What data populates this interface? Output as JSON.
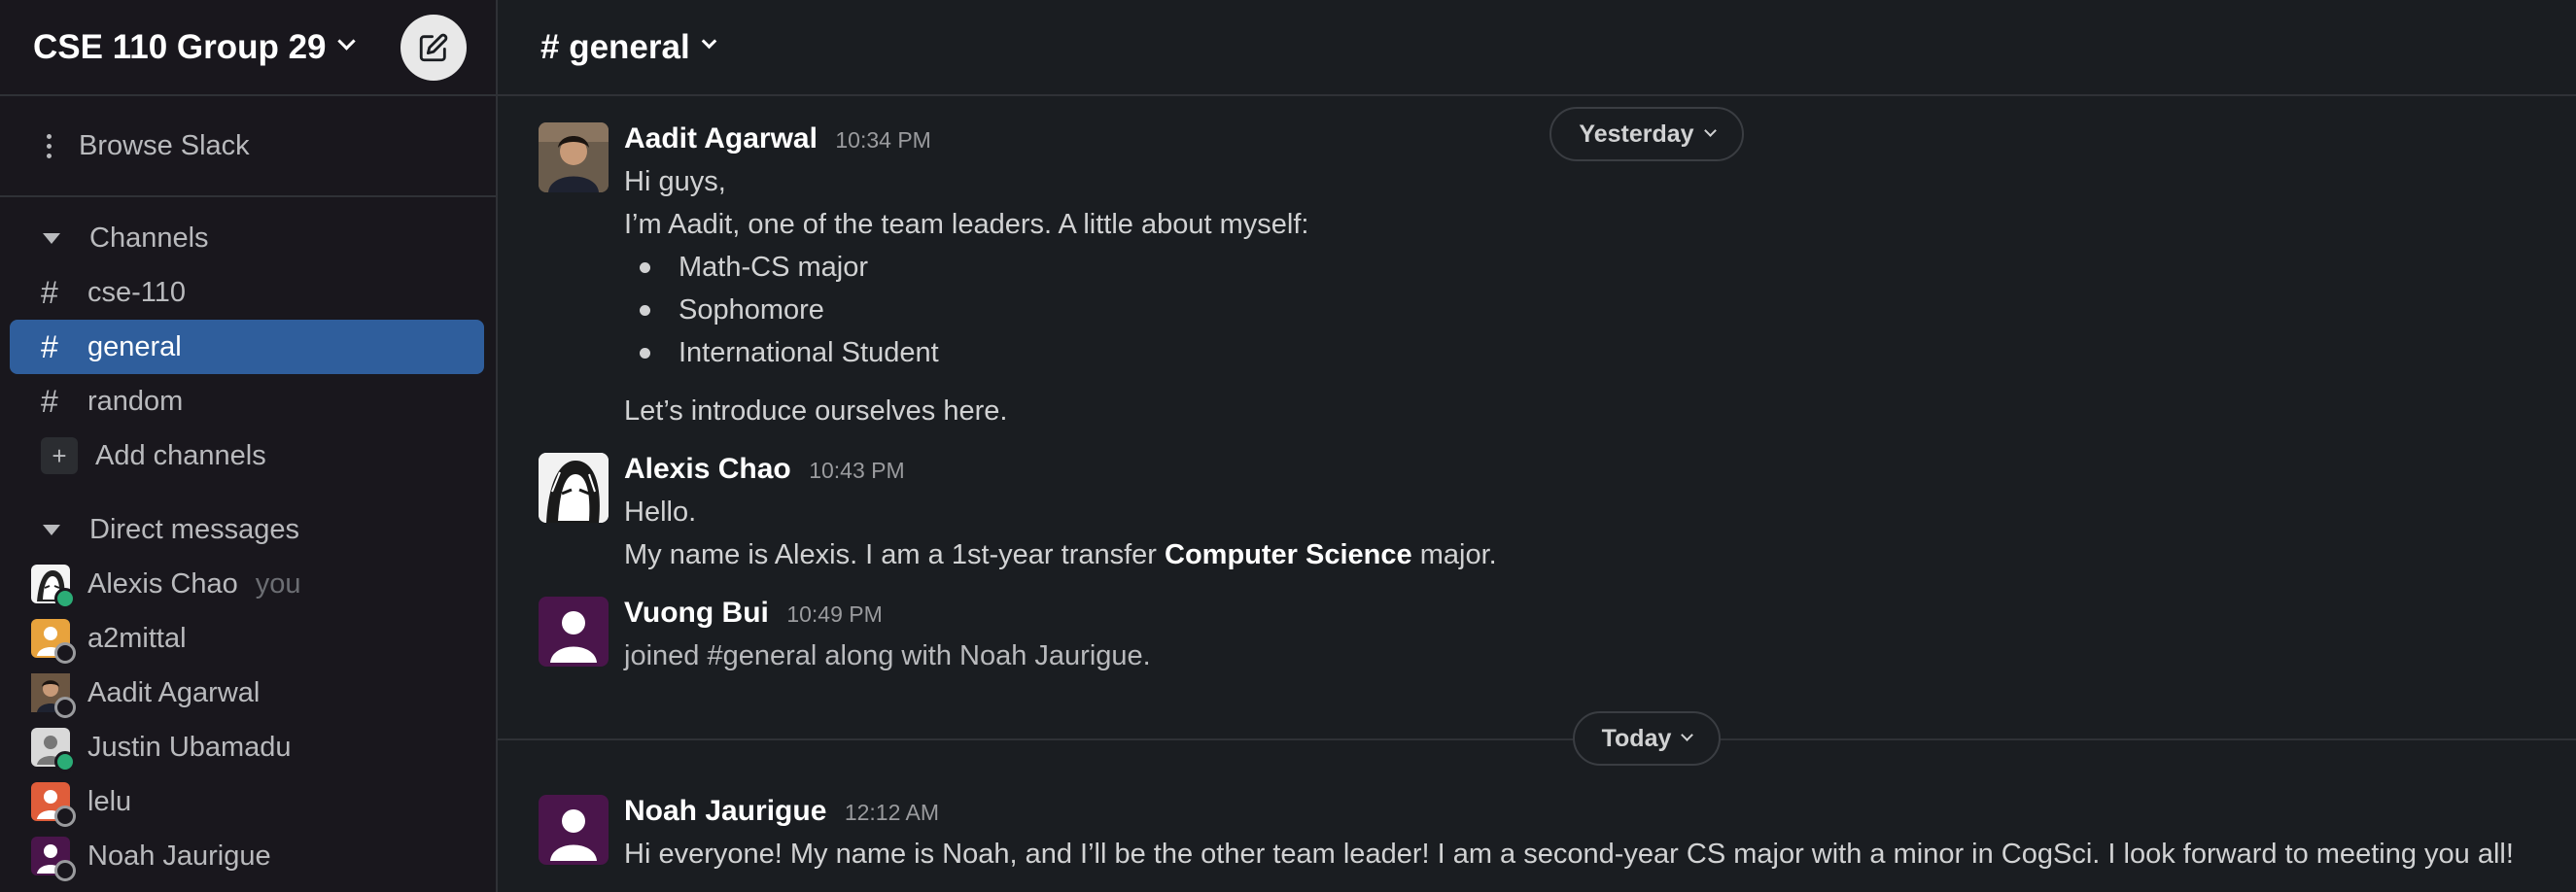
{
  "workspace": {
    "name": "CSE 110 Group 29"
  },
  "sidebar": {
    "browse_label": "Browse Slack",
    "channels_header": "Channels",
    "channels": [
      {
        "name": "cse-110",
        "active": false
      },
      {
        "name": "general",
        "active": true
      },
      {
        "name": "random",
        "active": false
      }
    ],
    "add_channels_label": "Add channels",
    "dm_header": "Direct messages",
    "dms": [
      {
        "name": "Alexis Chao",
        "suffix": "you",
        "status": "online"
      },
      {
        "name": "a2mittal",
        "status": "away"
      },
      {
        "name": "Aadit Agarwal",
        "status": "away"
      },
      {
        "name": "Justin Ubamadu",
        "status": "online"
      },
      {
        "name": "lelu",
        "status": "away"
      },
      {
        "name": "Noah Jaurigue",
        "status": "away"
      }
    ]
  },
  "channel": {
    "title": "# general"
  },
  "messages": [
    {
      "author": "Aadit Agarwal",
      "time": "10:34 PM",
      "lines": [
        "Hi guys,",
        "I’m Aadit, one of the team leaders. A little about myself:"
      ],
      "bullets": [
        "Math-CS major",
        "Sophomore",
        "International Student"
      ],
      "after": "Let’s introduce ourselves here."
    },
    {
      "author": "Alexis Chao",
      "time": "10:43 PM",
      "lines": [
        "Hello."
      ],
      "rich_pre": "My name is Alexis. I am a 1st-year transfer ",
      "rich_bold": "Computer Science",
      "rich_post": " major."
    },
    {
      "author": "Vuong Bui",
      "time": "10:49 PM",
      "lines": [
        "joined #general along with Noah Jaurigue."
      ]
    },
    {
      "author": "Noah Jaurigue",
      "time": "12:12 AM",
      "lines": [
        "Hi everyone! My name is Noah, and I’ll be the other team leader! I am a second-year CS major with a minor in CogSci. I look forward to meeting you all!"
      ]
    }
  ],
  "date_dividers": {
    "yesterday": "Yesterday",
    "today": "Today"
  },
  "colors": {
    "active_channel": "#2f5e9c",
    "online": "#2bac76",
    "purple_avatar": "#4a154b"
  }
}
